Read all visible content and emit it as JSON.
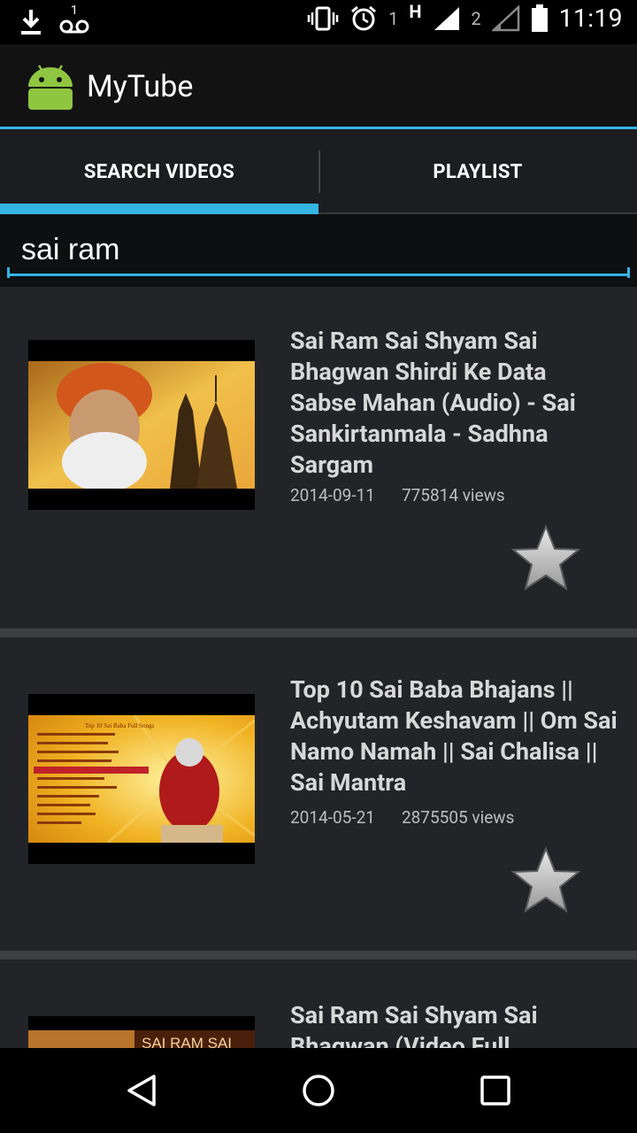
{
  "status_bar": {
    "time": "11:19",
    "sim1_label": "1",
    "network_type": "H",
    "sim2_label": "2",
    "voicemail_count": "1",
    "icons": [
      "download-icon",
      "voicemail-icon",
      "vibrate-icon",
      "alarm-icon",
      "signal-icon",
      "signal-icon-2",
      "battery-icon"
    ]
  },
  "app": {
    "title": "MyTube",
    "icon": "android-icon"
  },
  "tabs": [
    {
      "label": "SEARCH VIDEOS",
      "selected": true
    },
    {
      "label": "PLAYLIST",
      "selected": false
    }
  ],
  "search": {
    "value": "sai ram"
  },
  "videos": [
    {
      "title": "Sai Ram Sai Shyam Sai Bhagwan Shirdi Ke Data Sabse Mahan (Audio) - Sai Sankirtanmala - Sadhna Sargam",
      "date": "2014-09-11",
      "views": "775814 views"
    },
    {
      "title": "Top 10  Sai Baba Bhajans || Achyutam Keshavam || Om Sai Namo Namah || Sai Chalisa || Sai Mantra",
      "date": "2014-05-21",
      "views": "2875505 views",
      "thumb_heading": "Top 10 Sai Baba Full Songs"
    },
    {
      "title": "Sai Ram Sai Shyam Sai Bhagwan (Video Full",
      "thumb_text": "SAI RAM SAI"
    }
  ],
  "colors": {
    "accent": "#33b5e5",
    "background": "#222427",
    "separator": "#3d3f42"
  }
}
